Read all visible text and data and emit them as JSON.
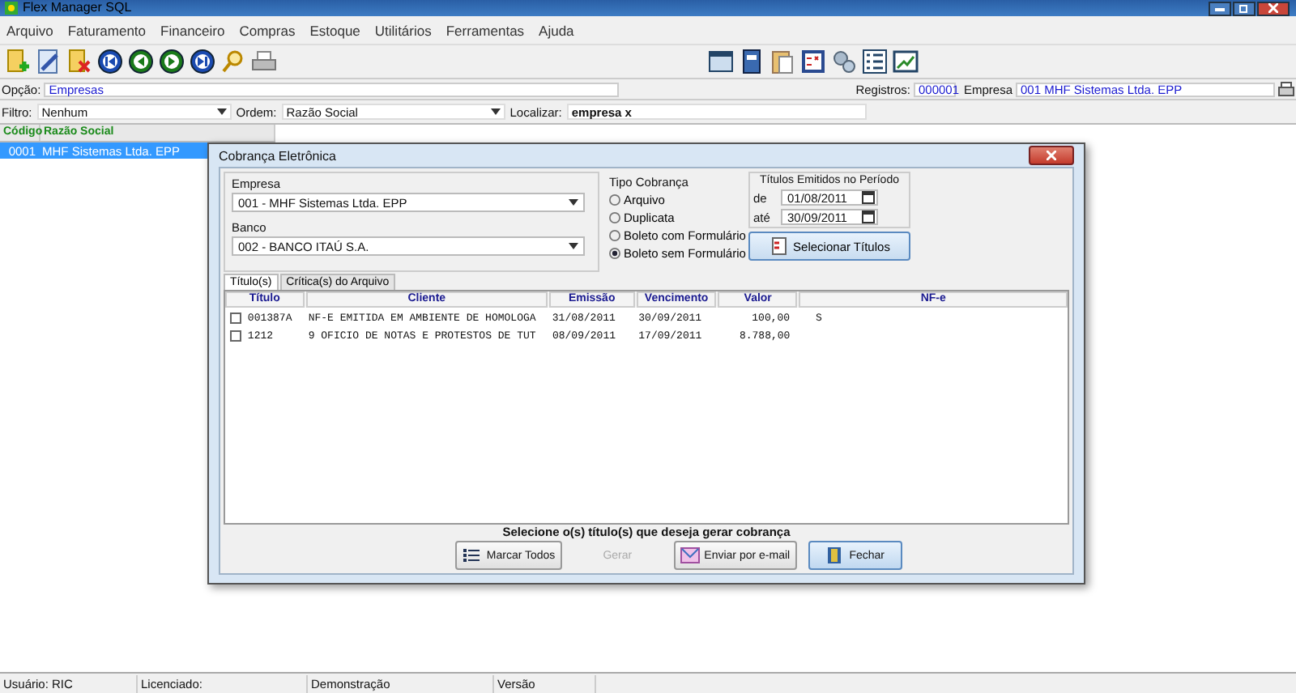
{
  "window": {
    "title": "Flex Manager SQL"
  },
  "menu": [
    "Arquivo",
    "Faturamento",
    "Financeiro",
    "Compras",
    "Estoque",
    "Utilitários",
    "Ferramentas",
    "Ajuda"
  ],
  "option": {
    "label": "Opção:",
    "value": "Empresas"
  },
  "registros": {
    "label": "Registros:",
    "value": "000001"
  },
  "empresa": {
    "label": "Empresa",
    "value": "001 MHF Sistemas Ltda. EPP"
  },
  "filters": [
    {
      "label": "Filtro:",
      "value": "Nenhum",
      "kind": "combo"
    },
    {
      "label": "Ordem:",
      "value": "Razão Social",
      "kind": "combo"
    },
    {
      "label": "Localizar:",
      "value": "empresa x",
      "kind": "text"
    }
  ],
  "grid": {
    "columns": [
      "Código",
      "Razão Social"
    ],
    "rows": [
      {
        "cells": [
          "0001",
          "MHF Sistemas Ltda. EPP"
        ],
        "selected": true
      }
    ]
  },
  "dialog": {
    "title": "Cobrança Eletrônica",
    "empresa": {
      "label": "Empresa",
      "value": "001 - MHF Sistemas Ltda. EPP"
    },
    "banco": {
      "label": "Banco",
      "value": "002 - BANCO ITAÚ S.A."
    },
    "tipo": {
      "label": "Tipo Cobrança",
      "options": [
        {
          "label": "Arquivo",
          "selected": false
        },
        {
          "label": "Duplicata",
          "selected": false
        },
        {
          "label": "Boleto com Formulário",
          "selected": false
        },
        {
          "label": "Boleto sem Formulário",
          "selected": true
        }
      ]
    },
    "periodo": {
      "title": "Títulos Emitidos no Período",
      "from_label": "de",
      "from": "01/08/2011",
      "to_label": "até",
      "to": "30/09/2011"
    },
    "select_button": "Selecionar Títulos",
    "tabs": [
      {
        "label": "Título(s)",
        "selected": true
      },
      {
        "label": "Crítica(s) do Arquivo",
        "selected": false
      }
    ],
    "table": {
      "columns": [
        "Título",
        "Cliente",
        "Emissão",
        "Vencimento",
        "Valor",
        "NF-e"
      ],
      "rows": [
        {
          "checked": false,
          "cells": [
            "001387A",
            "NF-E EMITIDA EM AMBIENTE DE HOMOLOGA",
            "31/08/2011",
            "30/09/2011",
            "100,00",
            "S"
          ]
        },
        {
          "checked": false,
          "cells": [
            "1212",
            "9 OFICIO DE NOTAS E PROTESTOS DE TUT",
            "08/09/2011",
            "17/09/2011",
            "8.788,00",
            ""
          ]
        }
      ]
    },
    "message": "Selecione o(s) título(s) que deseja gerar cobrança",
    "buttons": [
      {
        "label": "Marcar Todos",
        "kind": "list",
        "disabled": false
      },
      {
        "label": "Gerar",
        "kind": "none",
        "disabled": true
      },
      {
        "label": "Enviar por e-mail",
        "kind": "mail",
        "disabled": false
      },
      {
        "label": "Fechar",
        "kind": "exit",
        "disabled": false
      }
    ]
  },
  "status_bar": [
    "Usuário: RIC",
    "Licenciado:",
    "Demonstração",
    "Versão"
  ]
}
